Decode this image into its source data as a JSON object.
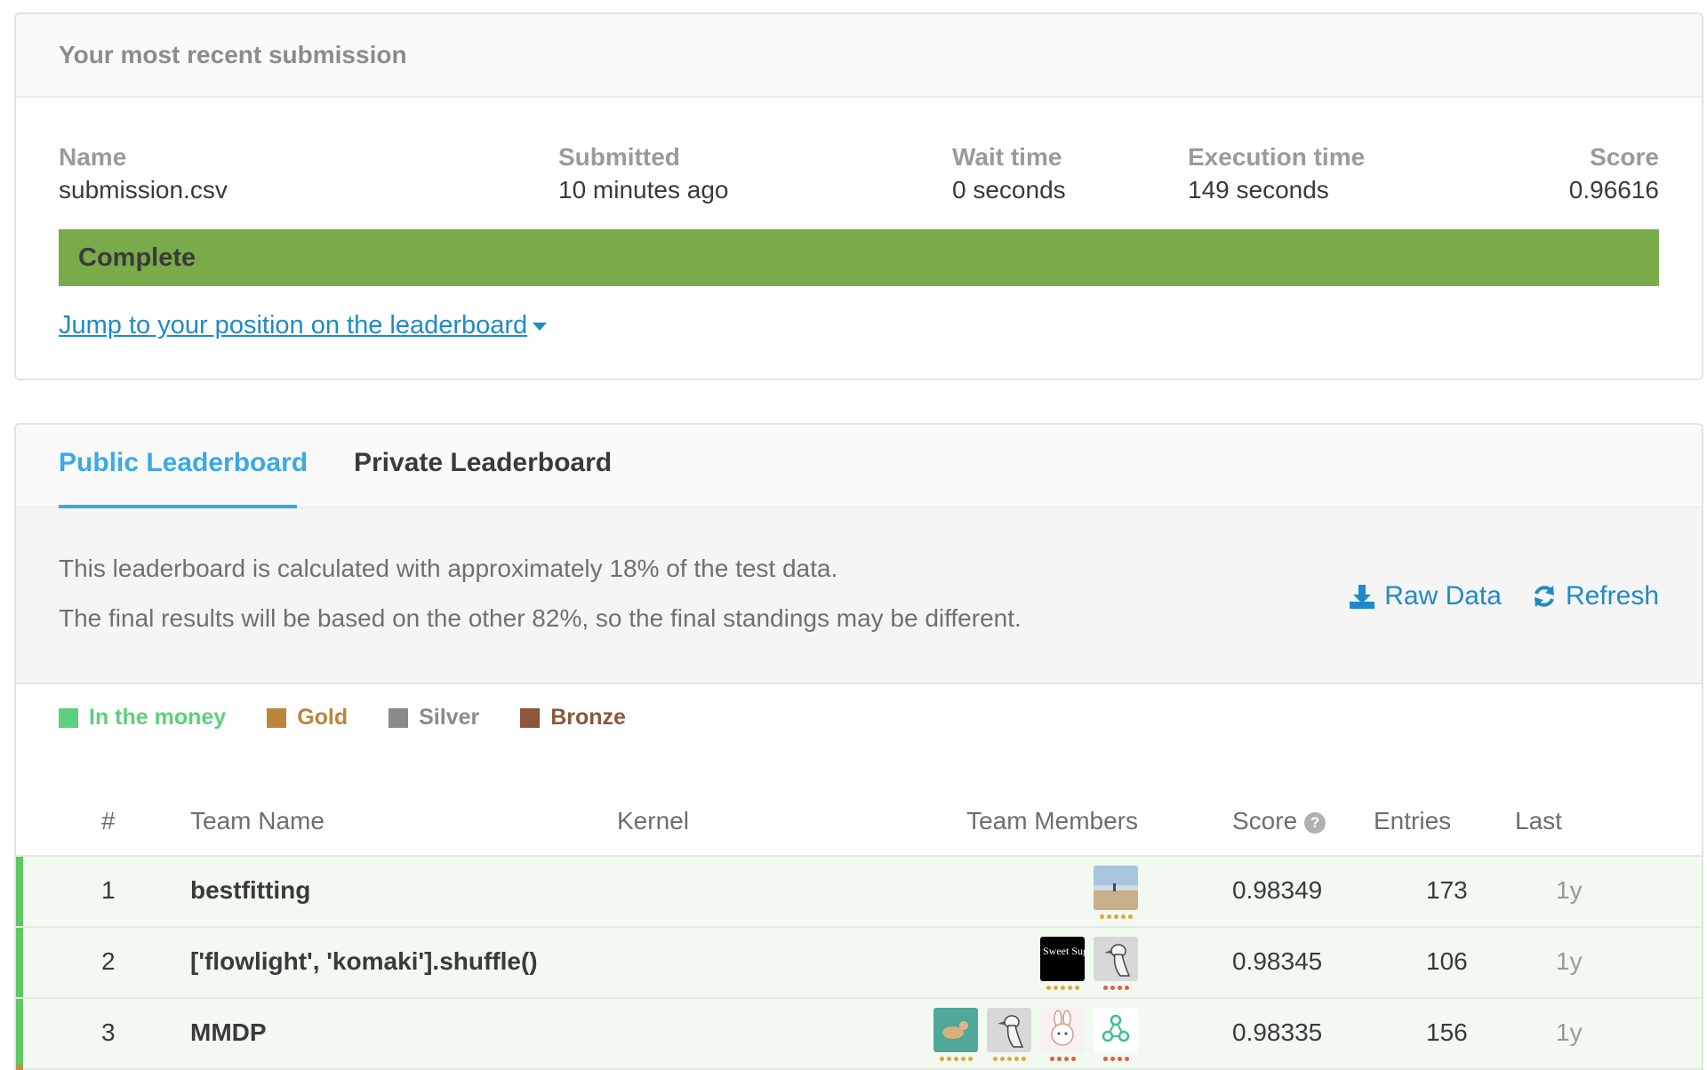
{
  "submission": {
    "header": "Your most recent submission",
    "columns": [
      {
        "label": "Name",
        "value": "submission.csv"
      },
      {
        "label": "Submitted",
        "value": "10 minutes ago"
      },
      {
        "label": "Wait time",
        "value": "0 seconds"
      },
      {
        "label": "Execution time",
        "value": "149 seconds"
      },
      {
        "label": "Score",
        "value": "0.96616"
      }
    ],
    "status": "Complete",
    "status_color": "#7aab4b",
    "jump_link": "Jump to your position on the leaderboard"
  },
  "tabs": [
    {
      "label": "Public Leaderboard",
      "active": true
    },
    {
      "label": "Private Leaderboard",
      "active": false
    }
  ],
  "notice": {
    "line1": "This leaderboard is calculated with approximately 18% of the test data.",
    "line2": "The final results will be based on the other 82%, so the final standings may be different.",
    "raw_data": "Raw Data",
    "refresh": "Refresh"
  },
  "legend": [
    {
      "label": "In the money",
      "color": "#5cd07c"
    },
    {
      "label": "Gold",
      "color": "#b8873a"
    },
    {
      "label": "Silver",
      "color": "#8a8a8a"
    },
    {
      "label": "Bronze",
      "color": "#8c5638"
    }
  ],
  "table": {
    "headers": {
      "rank": "#",
      "team": "Team Name",
      "kernel": "Kernel",
      "members": "Team Members",
      "score": "Score",
      "entries": "Entries",
      "last": "Last"
    },
    "rows": [
      {
        "rank": "1",
        "team": "bestfitting",
        "score": "0.98349",
        "entries": "173",
        "last": "1y",
        "members": [
          {
            "avatar": "beach-photo",
            "tier": "gold"
          }
        ]
      },
      {
        "rank": "2",
        "team": "['flowlight', 'komaki'].shuffle()",
        "score": "0.98345",
        "entries": "106",
        "last": "1y",
        "members": [
          {
            "avatar": "sweet-sugar-logo",
            "tier": "gold",
            "text": "Sweet Sugar"
          },
          {
            "avatar": "goose-sketch",
            "tier": "expert"
          }
        ]
      },
      {
        "rank": "3",
        "team": "MMDP",
        "score": "0.98335",
        "entries": "156",
        "last": "1y",
        "members": [
          {
            "avatar": "swimmer-photo",
            "tier": "gold"
          },
          {
            "avatar": "goose-sketch",
            "tier": "gold"
          },
          {
            "avatar": "bunny-drawing",
            "tier": "expert"
          },
          {
            "avatar": "molecule-icon",
            "tier": "expert"
          }
        ]
      }
    ]
  },
  "tier_colors": {
    "gold": "#e0a83a",
    "expert": "#e85b3c"
  }
}
